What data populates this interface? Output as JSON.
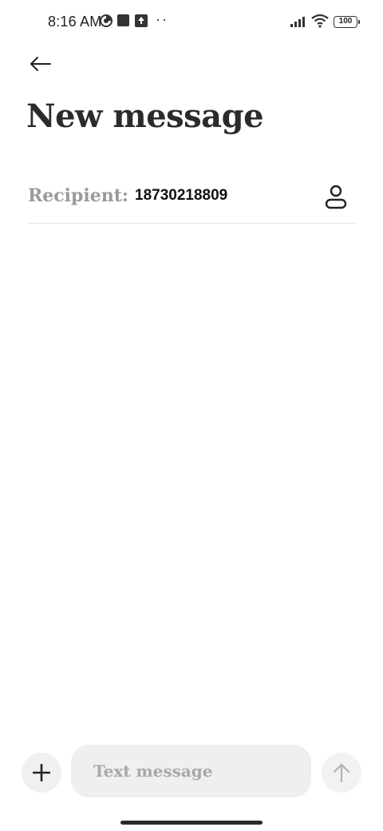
{
  "status_bar": {
    "time": "8:16 AM",
    "battery": "100",
    "icons": [
      "data-saver-icon",
      "square-notification-icon",
      "upload-notification-icon",
      "more-notifications-icon",
      "signal-icon",
      "wifi-icon",
      "battery-icon"
    ]
  },
  "header": {
    "back_icon": "back-arrow-icon",
    "title": "New message"
  },
  "recipient": {
    "label": "Recipient:",
    "value": "18730218809",
    "contact_icon": "person-icon"
  },
  "composer": {
    "add_icon": "plus-icon",
    "placeholder": "Text message",
    "value": "",
    "send_icon": "send-arrow-icon"
  }
}
